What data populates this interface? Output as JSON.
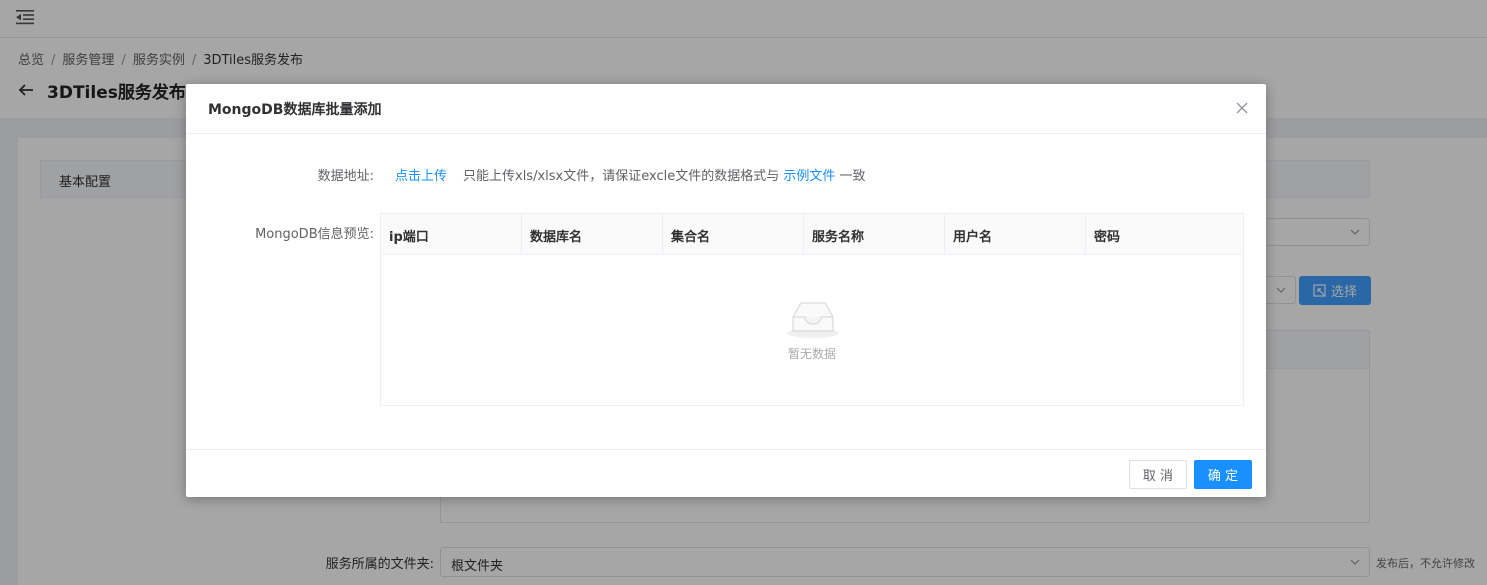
{
  "background": {
    "breadcrumb": [
      "总览",
      "服务管理",
      "服务实例",
      "3DTiles服务发布"
    ],
    "breadcrumb_separator": "/",
    "page_title": "3DTiles服务发布",
    "section_title": "基本配置",
    "select_button_label": "选择",
    "folder_label": "服务所属的文件夹:",
    "folder_value": "根文件夹",
    "folder_hint": "发布后，不允许修改"
  },
  "dialog": {
    "title": "MongoDB数据库批量添加",
    "data_address_label": "数据地址:",
    "upload_link": "点击上传",
    "upload_hint_prefix": "只能上传xls/xlsx文件，请保证excle文件的数据格式与",
    "sample_file_link": "示例文件",
    "upload_hint_suffix": "一致",
    "preview_label": "MongoDB信息预览:",
    "table_columns": [
      "ip端口",
      "数据库名",
      "集合名",
      "服务名称",
      "用户名",
      "密码"
    ],
    "empty_text": "暂无数据",
    "cancel_label": "取 消",
    "confirm_label": "确 定"
  },
  "colors": {
    "primary": "#1890ff",
    "overlay": "rgba(0,0,0,0.35)"
  }
}
